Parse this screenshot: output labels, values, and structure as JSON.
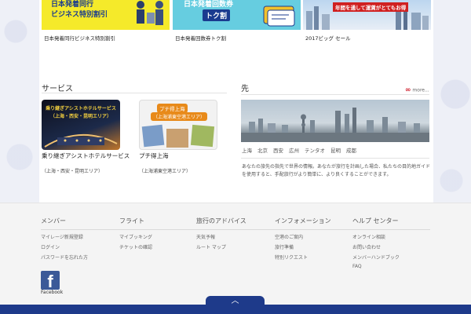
{
  "promos": [
    {
      "caption": "日本発着同行ビジネス特別割引",
      "img_line1": "日本発着同行",
      "img_line2": "ビジネス特別割引"
    },
    {
      "caption": "日本発着回数券トク割",
      "img_line1": "日本発着回数券",
      "img_line2": "トク割"
    },
    {
      "caption": "2017ビッグ セール",
      "img_line1": "年間を通して運賃がとてもお得"
    }
  ],
  "services": {
    "title": "サービス",
    "cards": [
      {
        "img_line1": "乗り継ぎアシストホテルサービス",
        "img_line2": "（上海・西安・昆明エリア）",
        "label": "乗り継ぎアシストホテルサービス",
        "sub": "（上海・西安・昆明エリア）"
      },
      {
        "img_line1": "プチ得上海",
        "img_line2": "（上海浦東空港エリア）",
        "label": "プチ得上海",
        "sub": "（上海浦東空港エリア）"
      }
    ]
  },
  "destinations": {
    "title": "先",
    "more_label": "more...",
    "cities": [
      "上海",
      "北京",
      "西安",
      "広州",
      "テンタオ",
      "昆明",
      "成都"
    ],
    "description": "あなたの旅先の指先で世界の情報。あなたが旅行を計画した場合、私たちの目的地ガイドを使用すると、手配旅行がより簡単に、より良くすることができます。"
  },
  "footer": {
    "columns": [
      {
        "heading": "メンバー",
        "links": [
          "マイレージ新規登録",
          "ログイン",
          "パスワードを忘れた方"
        ]
      },
      {
        "heading": "フライト",
        "links": [
          "マイブッキング",
          "チケットの確認"
        ]
      },
      {
        "heading": "旅行のアドバイス",
        "links": [
          "天気予報",
          "ルート マップ"
        ]
      },
      {
        "heading": "インフォメーション",
        "links": [
          "空港のご案内",
          "旅行準備",
          "特別リクエスト"
        ]
      },
      {
        "heading": "ヘルプ センター",
        "links": [
          "オンライン相談",
          "お問い合わせ",
          "メンバーハンドブック",
          "FAQ"
        ]
      }
    ],
    "facebook_label": "Facebook",
    "facebook_glyph": "f",
    "back_to_top_glyph": "︿"
  },
  "colors": {
    "accent_blue": "#1e3a8a",
    "facebook": "#3b5998",
    "promo_yellow": "#f5ea2a",
    "promo_cyan": "#66cde0"
  }
}
